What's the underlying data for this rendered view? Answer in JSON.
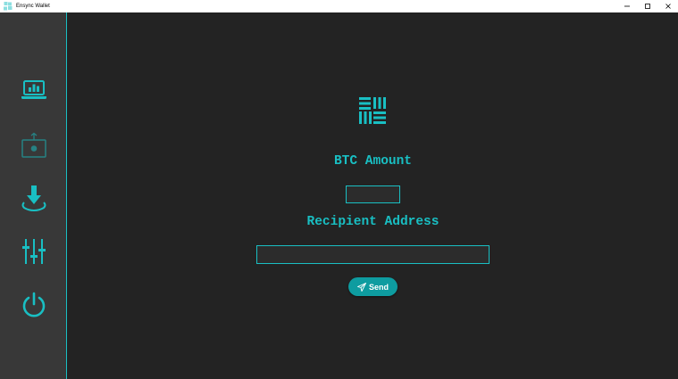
{
  "window": {
    "title": "Ensync Wallet",
    "controls": [
      "minimize",
      "maximize",
      "close"
    ]
  },
  "sidebar": {
    "items": [
      {
        "name": "dashboard",
        "icon": "laptop-chart-icon",
        "active": true
      },
      {
        "name": "receive",
        "icon": "safe-icon",
        "active": false
      },
      {
        "name": "download",
        "icon": "download-icon",
        "active": true
      },
      {
        "name": "settings",
        "icon": "sliders-icon",
        "active": true
      },
      {
        "name": "power",
        "icon": "power-icon",
        "active": true
      }
    ]
  },
  "form": {
    "logo_icon": "ensync-logo-icon",
    "amount_label": "BTC Amount",
    "amount_value": "",
    "address_label": "Recipient Address",
    "address_value": "",
    "send_label": "Send",
    "send_icon": "paper-plane-icon"
  },
  "colors": {
    "accent": "#19bfc3",
    "sidebar_bg": "#383838",
    "main_bg": "#232323",
    "button_bg": "#0e9ca0"
  }
}
